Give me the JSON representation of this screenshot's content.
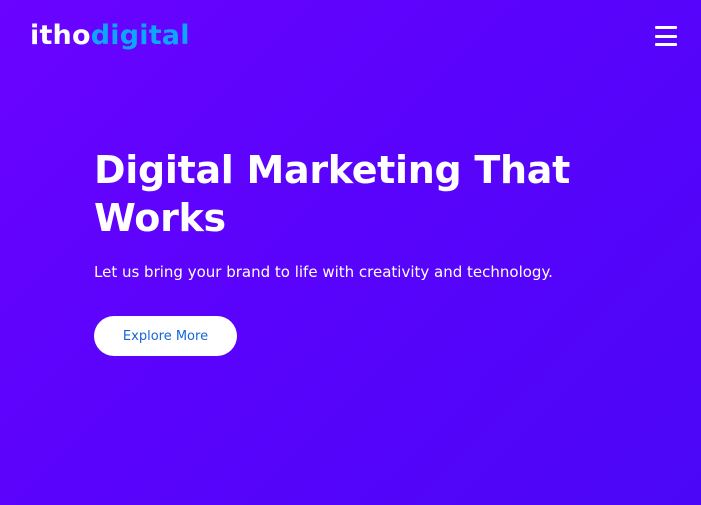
{
  "header": {
    "logo_part1": "itho",
    "logo_part2": "digital",
    "menu_icon": "hamburger-menu-icon"
  },
  "hero": {
    "title": "Digital Marketing That Works",
    "subtitle": "Let us bring your brand to life with creativity and technology.",
    "cta_label": "Explore More"
  },
  "colors": {
    "background_start": "#6a03ff",
    "background_end": "#4b06f7",
    "logo_accent": "#0ea5ff",
    "cta_text": "#1565d8",
    "cta_background": "#ffffff"
  }
}
